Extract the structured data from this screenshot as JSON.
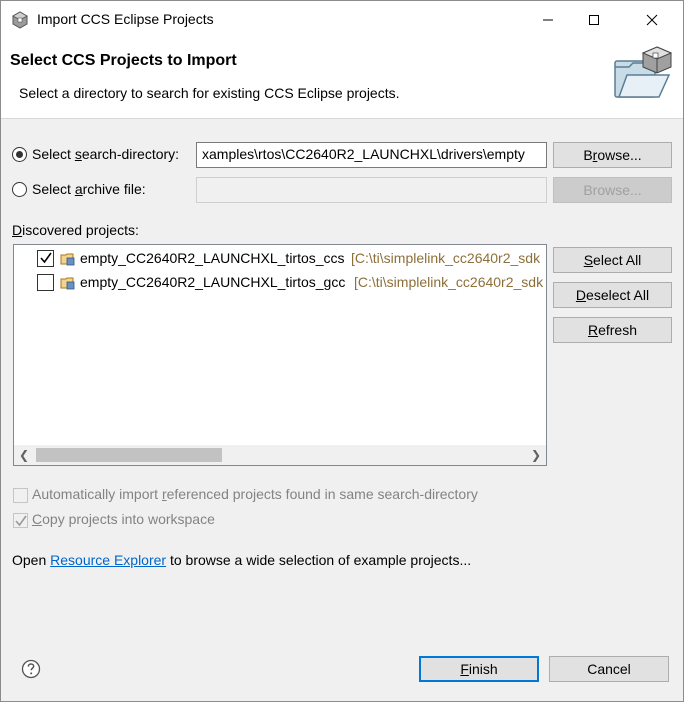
{
  "window": {
    "title": "Import CCS Eclipse Projects",
    "app_icon": "eclipse-gear-icon"
  },
  "header": {
    "title": "Select CCS Projects to Import",
    "subtitle": "Select a directory to search for existing CCS Eclipse projects.",
    "graphic": "import-folder-icon"
  },
  "source": {
    "search_dir": {
      "label_pre": "Select ",
      "label_u": "s",
      "label_post": "earch-directory:",
      "selected": true,
      "value": "xamples\\rtos\\CC2640R2_LAUNCHXL\\drivers\\empty",
      "browse_pre": "B",
      "browse_u": "r",
      "browse_post": "owse..."
    },
    "archive": {
      "label_pre": "Select ",
      "label_u": "a",
      "label_post": "rchive file:",
      "selected": false,
      "value": "",
      "browse_label": "Browse..."
    }
  },
  "discovered": {
    "label_pre": "",
    "label_u": "D",
    "label_post": "iscovered projects:",
    "items": [
      {
        "name": "empty_CC2640R2_LAUNCHXL_tirtos_ccs",
        "path": "[C:\\ti\\simplelink_cc2640r2_sdk",
        "checked": true
      },
      {
        "name": "empty_CC2640R2_LAUNCHXL_tirtos_gcc",
        "path": "[C:\\ti\\simplelink_cc2640r2_sdk",
        "checked": false
      }
    ]
  },
  "side_buttons": {
    "select_all_pre": "",
    "select_all_u": "S",
    "select_all_post": "elect All",
    "deselect_all_pre": "",
    "deselect_all_u": "D",
    "deselect_all_post": "eselect All",
    "refresh_pre": "",
    "refresh_u": "R",
    "refresh_post": "efresh"
  },
  "options": {
    "auto_import_pre": "Automatically import ",
    "auto_import_u": "r",
    "auto_import_post": "eferenced projects found in same search-directory",
    "auto_import_checked": false,
    "copy_pre": "",
    "copy_u": "C",
    "copy_post": "opy projects into workspace",
    "copy_checked": true
  },
  "explorer": {
    "pre": "Open ",
    "link": "Resource Explorer",
    "post": " to browse a wide selection of example projects..."
  },
  "footer": {
    "finish_pre": "",
    "finish_u": "F",
    "finish_post": "inish",
    "cancel_label": "Cancel"
  },
  "colors": {
    "accent": "#0078d7",
    "link": "#0066cc",
    "path_text": "#8e6f3a"
  }
}
